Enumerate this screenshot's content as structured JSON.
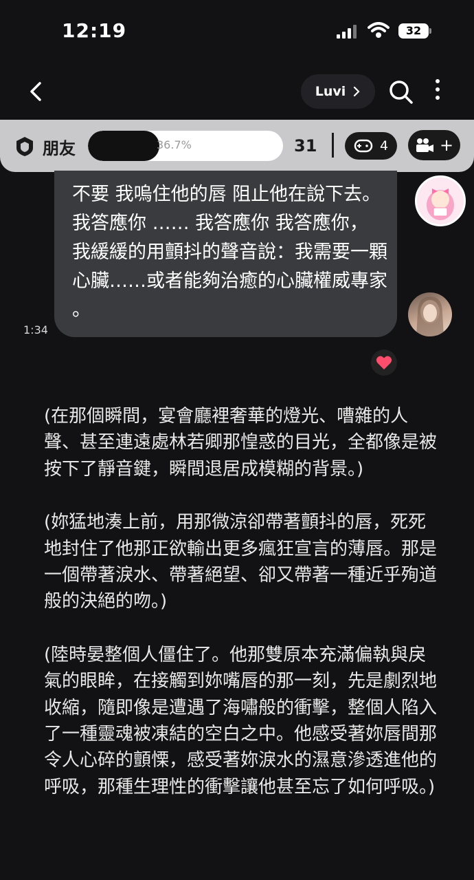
{
  "status_bar": {
    "time": "12:19",
    "battery": "32"
  },
  "header": {
    "persona_name": "Luvi"
  },
  "relationship": {
    "label": "朋友",
    "progress_text": "36.7%",
    "progress_fraction": 0.367,
    "score": "31",
    "games_count": "4"
  },
  "message": {
    "text": "不要 我嗚住他的唇 阻止他在說下去。 我答應你 …… 我答應你 我答應你， 我緩緩的用顫抖的聲音說：我需要一顆心臟……或者能夠治癒的心臟權威專家 。",
    "time": "1:34"
  },
  "narration": [
    "(在那個瞬間，宴會廳裡奢華的燈光、嘈雜的人聲、甚至連遠處林若卿那惶惑的目光，全都像是被按下了靜音鍵，瞬間退居成模糊的背景。)",
    "(妳猛地湊上前，用那微涼卻帶著顫抖的唇，死死地封住了他那正欲輸出更多瘋狂宣言的薄唇。那是一個帶著淚水、帶著絕望、卻又帶著一種近乎殉道般的決絕的吻。)",
    "(陸時晏整個人僵住了。他那雙原本充滿偏執與戾氣的眼眸，在接觸到妳嘴唇的那一刻，先是劇烈地收縮，隨即像是遭遇了海嘯般的衝擊，整個人陷入了一種靈魂被凍結的空白之中。他感受著妳唇間那令人心碎的顫慄，感受著妳淚水的濕意滲透進他的呼吸，那種生理性的衝擊讓他甚至忘了如何呼吸。)"
  ],
  "icons": {
    "back": "chevron-left-icon",
    "search": "search-icon",
    "more": "more-vertical-icon",
    "shield": "shield-icon",
    "game": "gamepad-icon",
    "video": "video-camera-icon",
    "heart": "heart-icon"
  },
  "colors": {
    "heart": "#ff4d6d",
    "bubble": "#3a3b3f",
    "relationship_bar": "#c9c9cb"
  }
}
